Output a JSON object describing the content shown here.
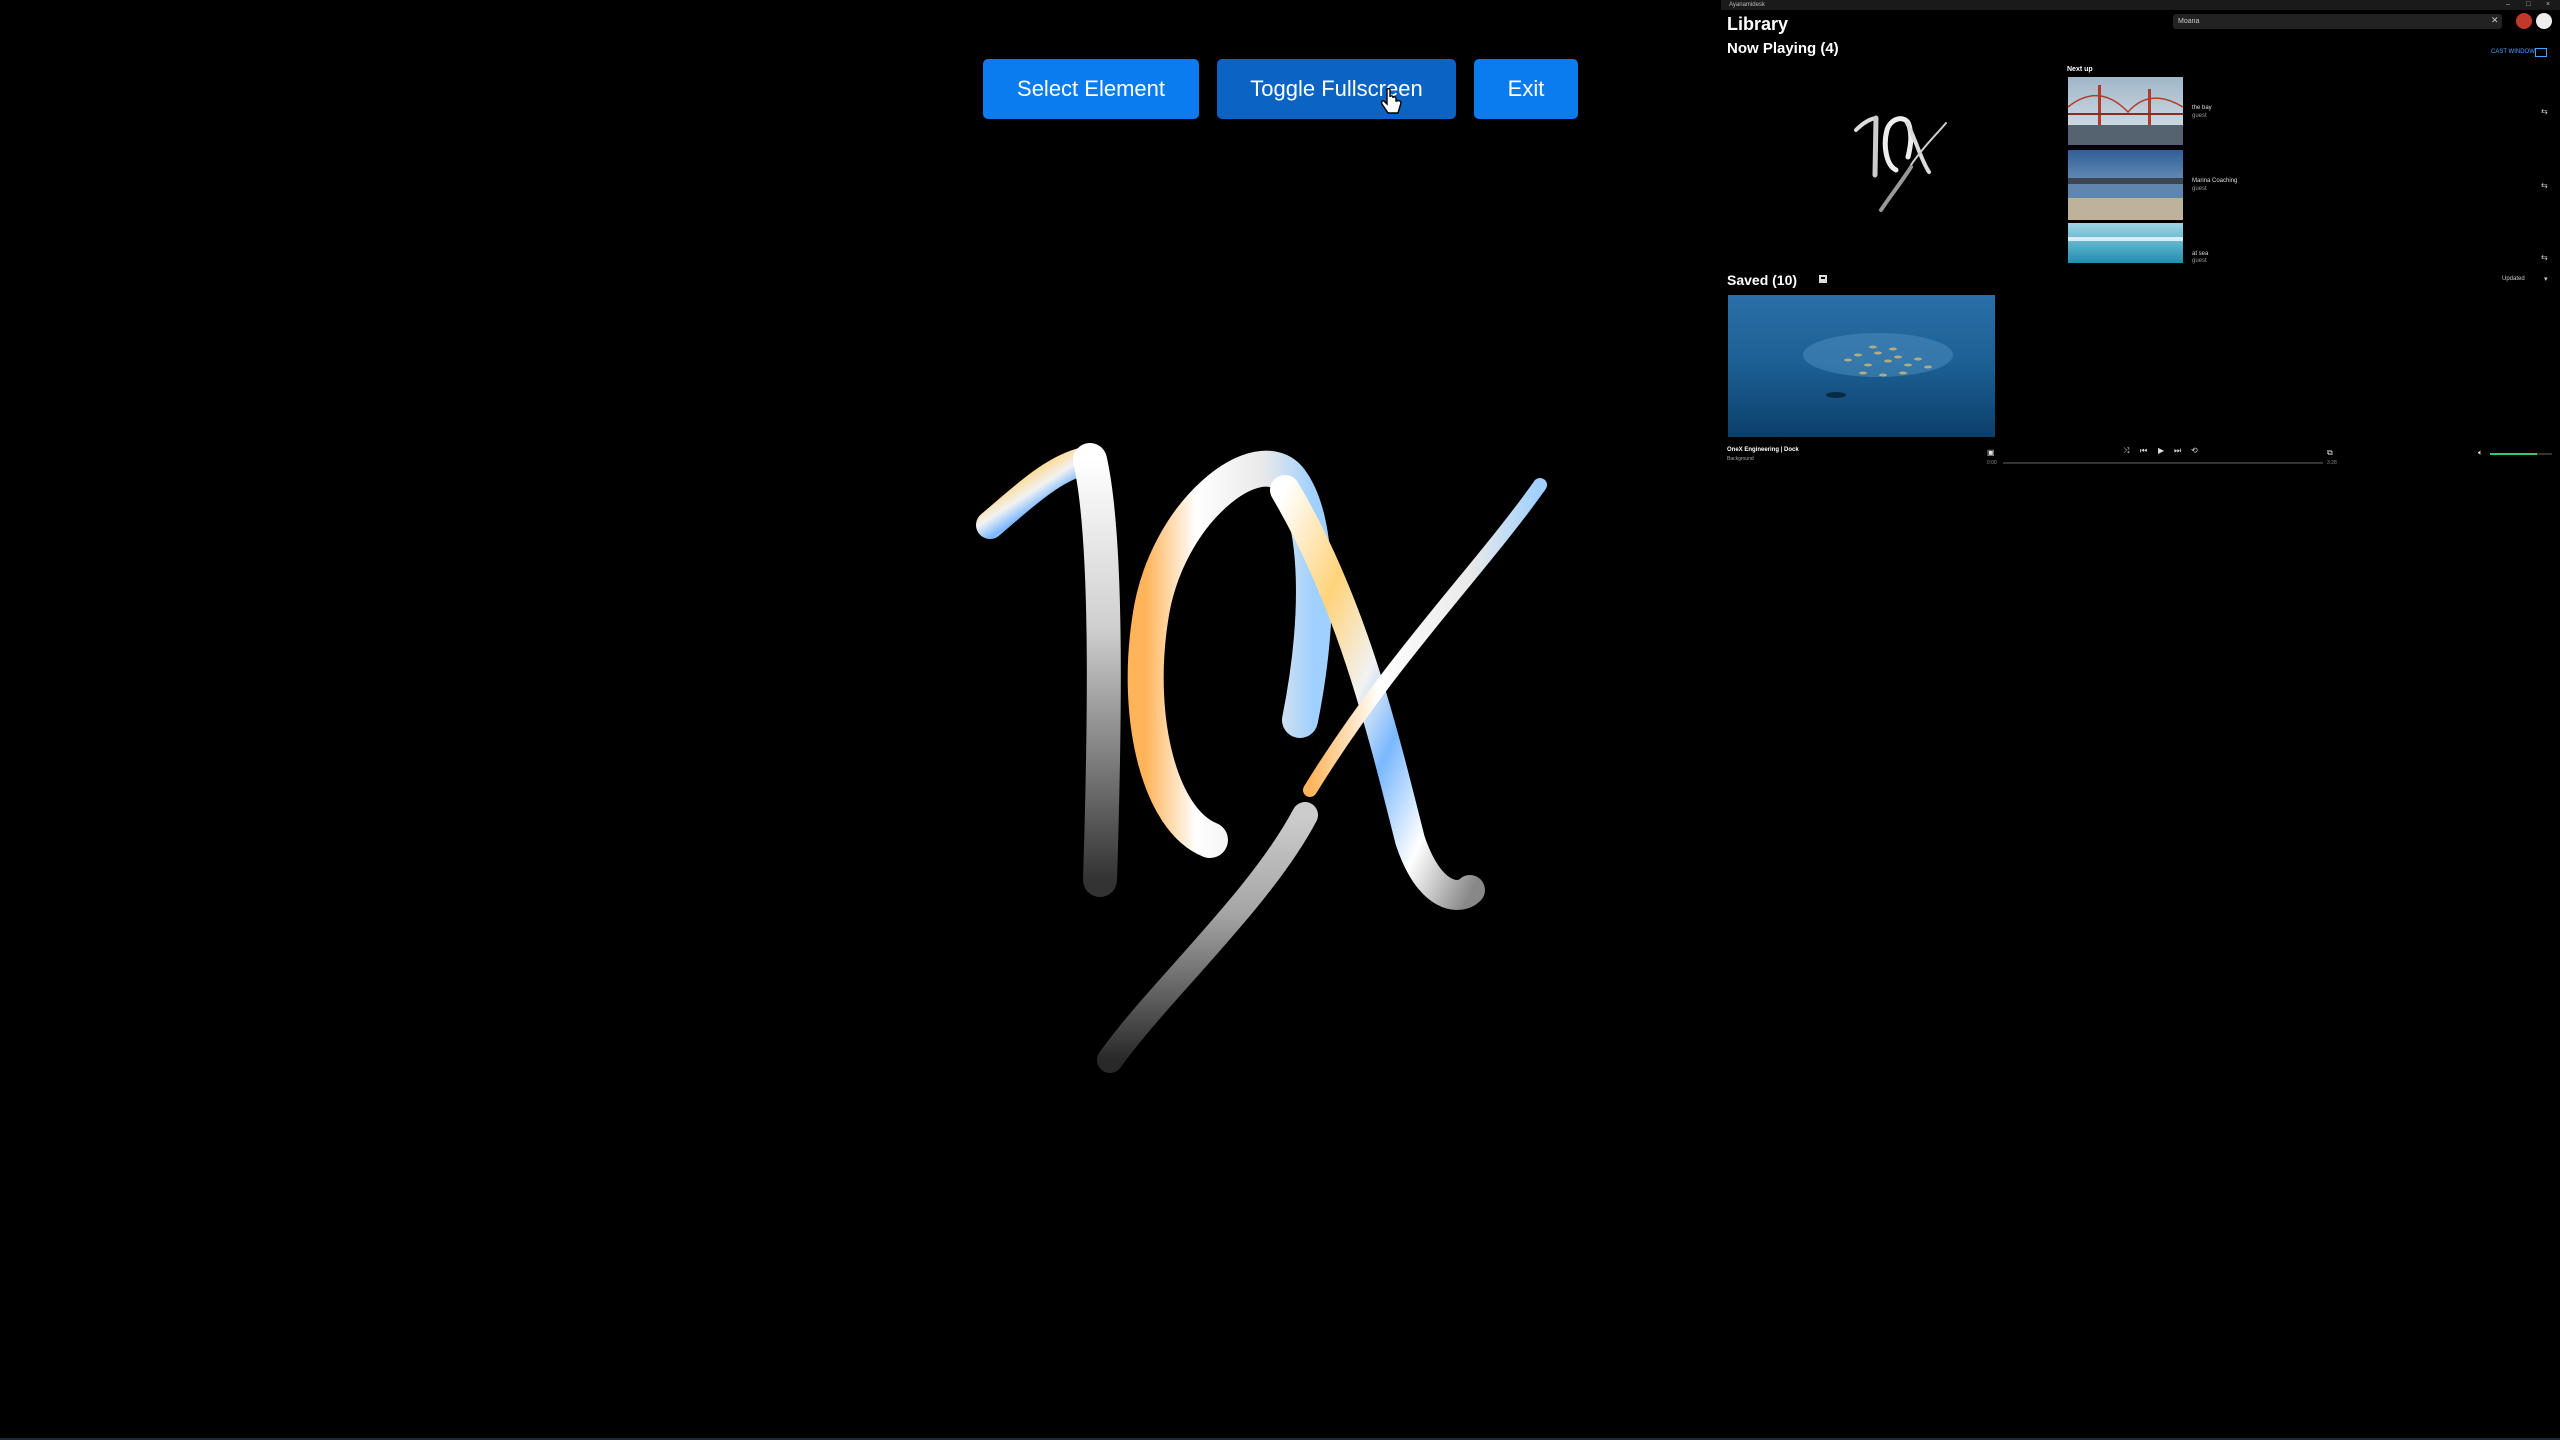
{
  "controls": {
    "select_element": "Select Element",
    "toggle_fullscreen": "Toggle Fullscreen",
    "exit": "Exit"
  },
  "library": {
    "window_title": "Ayanamidesk",
    "title": "Library",
    "search_value": "Moana",
    "now_playing_title": "Now Playing (4)",
    "cast_label": "CAST WINDOW",
    "next_up_label": "Next up",
    "queue": [
      {
        "title": "the bay",
        "subtitle": "guest"
      },
      {
        "title": "Marina Coaching",
        "subtitle": "guest"
      },
      {
        "title": "at sea",
        "subtitle": "guest"
      }
    ],
    "saved_title": "Saved (10)",
    "sort_label": "Updated"
  },
  "player": {
    "title": "OneX Engineering | Dock",
    "subtitle": "Background",
    "time_current": "0:00",
    "time_total": "3:28",
    "volume": 0.75
  },
  "colors": {
    "button_blue": "#0a7cf0",
    "button_active": "#0b63c4",
    "volume_green": "#2ecc71"
  },
  "icons": [
    "cursor-hand-icon",
    "close-icon",
    "logo-icon",
    "avatar-icon",
    "cast-icon",
    "queue-add-icon",
    "bookmark-icon",
    "chevron-down-icon",
    "caption-icon",
    "shuffle-icon",
    "previous-icon",
    "play-icon",
    "next-icon",
    "repeat-icon",
    "pip-icon",
    "volume-icon"
  ]
}
